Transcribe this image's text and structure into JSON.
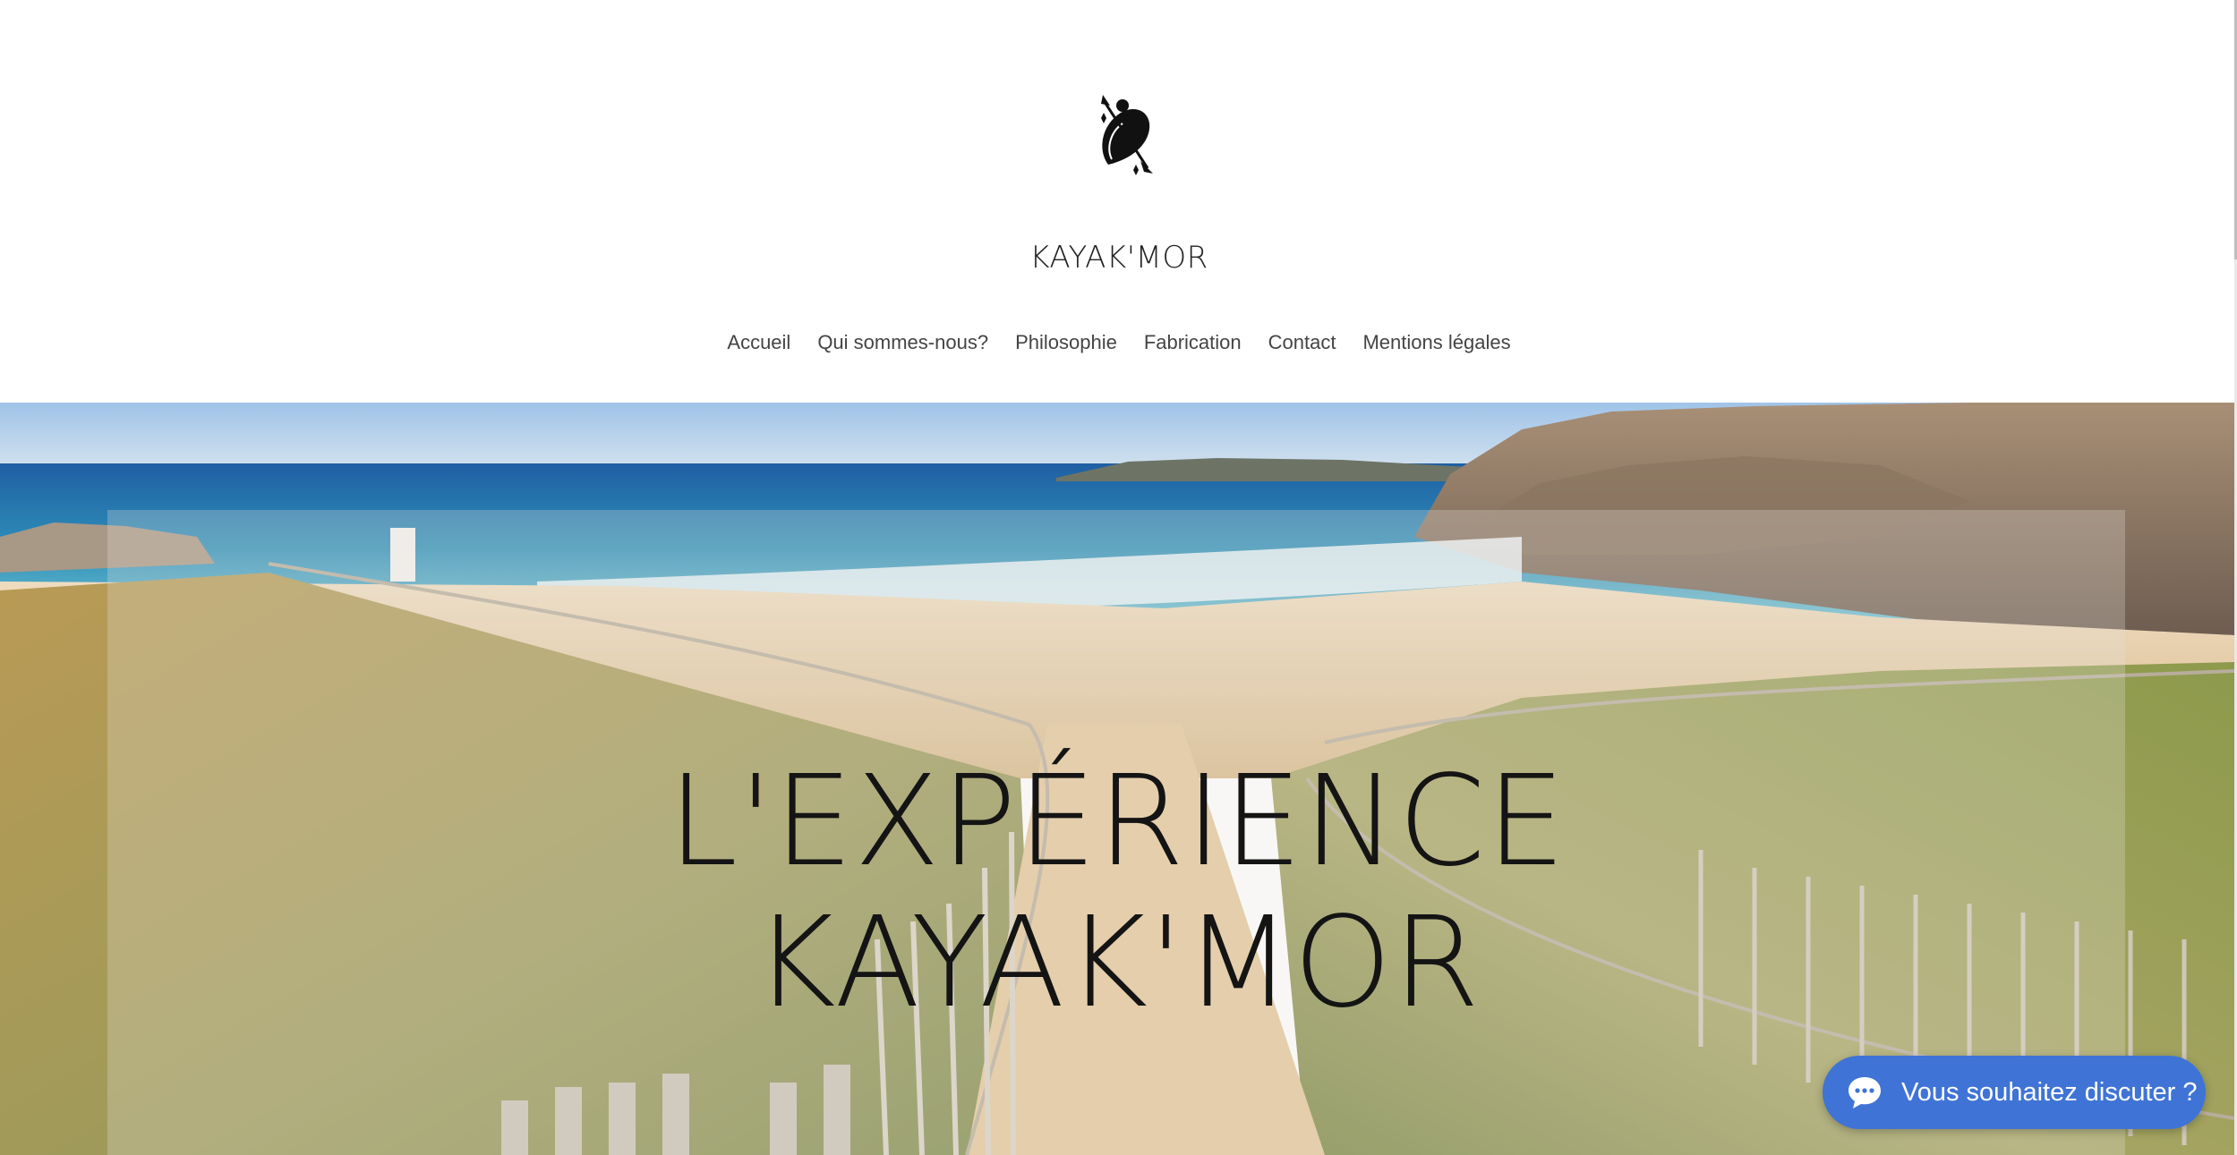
{
  "site": {
    "title": "KAYAK'MOR",
    "logo": "kayak-paddler-logo"
  },
  "nav": {
    "items": [
      {
        "label": "Accueil"
      },
      {
        "label": "Qui sommes-nous?"
      },
      {
        "label": "Philosophie"
      },
      {
        "label": "Fabrication"
      },
      {
        "label": "Contact"
      },
      {
        "label": "Mentions légales"
      }
    ]
  },
  "hero": {
    "title_line1": "L'EXPÉRIENCE",
    "title_line2": "KAYAK'MOR",
    "background": "beach-path-dunes-ocean-photo"
  },
  "chat": {
    "label": "Vous souhaitez discuter ?",
    "icon": "chat-bubble-icon",
    "color": "#3f74d6"
  },
  "colors": {
    "text": "#222222",
    "nav_text": "#444444",
    "chat": "#3f74d6"
  }
}
